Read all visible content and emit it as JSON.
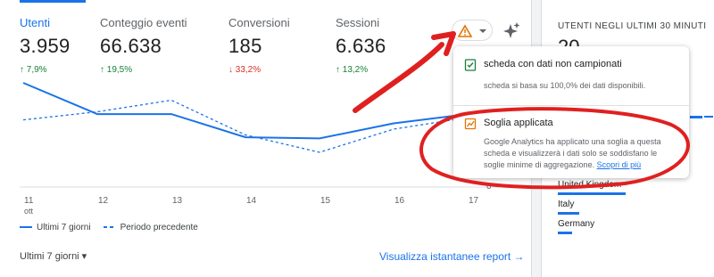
{
  "metrics": [
    {
      "label": "Utenti",
      "value": "3.959",
      "change": "↑ 7,9%",
      "dir": "up"
    },
    {
      "label": "Conteggio eventi",
      "value": "66.638",
      "change": "↑ 19,5%",
      "dir": "up"
    },
    {
      "label": "Conversioni",
      "value": "185",
      "change": "↓ 33,2%",
      "dir": "down"
    },
    {
      "label": "Sessioni",
      "value": "6.636",
      "change": "↑ 13,2%",
      "dir": "up"
    }
  ],
  "chart_data": {
    "type": "line",
    "x": [
      "11",
      "12",
      "13",
      "14",
      "15",
      "16",
      "17"
    ],
    "x_sublabel": "ott",
    "y_tick": "0",
    "series": [
      {
        "name": "Ultimi 7 giorni",
        "values": [
          0.9,
          0.63,
          0.63,
          0.43,
          0.42,
          0.55,
          0.63
        ]
      },
      {
        "name": "Periodo precedente",
        "values": [
          0.58,
          0.65,
          0.75,
          0.45,
          0.3,
          0.5,
          0.6
        ]
      }
    ],
    "colors": {
      "line": "#1a73e8"
    }
  },
  "legend": {
    "current": "Ultimi 7 giorni",
    "previous": "Periodo precedente"
  },
  "footer": {
    "period": "Ultimi 7 giorni ▾",
    "report_link": "Visualizza istantanee report →"
  },
  "side": {
    "title": "UTENTI NEGLI ULTIMI 30 MINUTI",
    "big": "20",
    "countries": [
      "United Kingdom",
      "Italy",
      "Germany"
    ]
  },
  "popup": {
    "row1_title": "scheda con dati non campionati",
    "row1_body": "scheda si basa su 100,0% dei dati disponibili.",
    "row2_title": "Soglia applicata",
    "row2_body": "Google Analytics ha applicato una soglia a questa scheda e visualizzerà i dati solo se soddisfano le soglie minime di aggregazione.",
    "row2_link": "Scopri di più"
  },
  "icons": [
    "warning-icon",
    "chevron-down-icon",
    "sparkle-icon",
    "check-doc-icon",
    "trend-chart-icon"
  ],
  "colors": {
    "accent": "#1a73e8",
    "up": "#188038",
    "down": "#d93025",
    "warning": "#e37400",
    "annotation": "#e02020"
  }
}
